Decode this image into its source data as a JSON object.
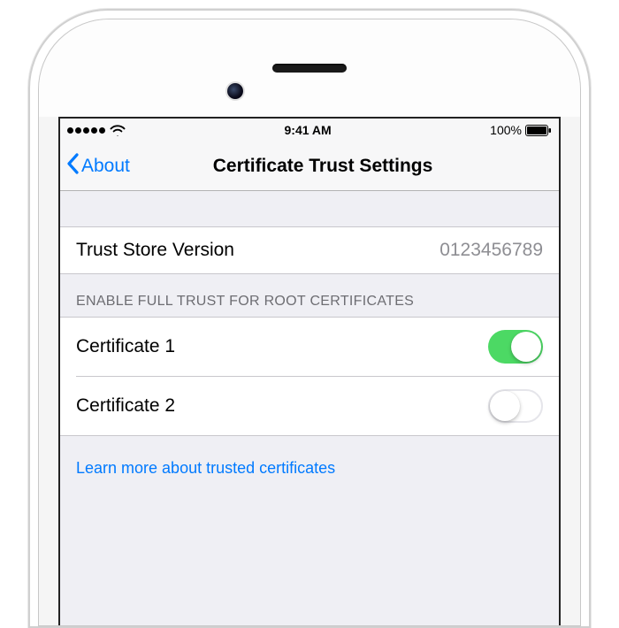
{
  "status_bar": {
    "time": "9:41 AM",
    "battery_pct": "100%"
  },
  "nav": {
    "back_label": "About",
    "title": "Certificate Trust Settings"
  },
  "version_row": {
    "label": "Trust Store Version",
    "value": "0123456789"
  },
  "section_header": "ENABLE FULL TRUST FOR ROOT CERTIFICATES",
  "certificates": [
    {
      "label": "Certificate 1",
      "enabled": true
    },
    {
      "label": "Certificate 2",
      "enabled": false
    }
  ],
  "footer_link": "Learn more about trusted certificates"
}
